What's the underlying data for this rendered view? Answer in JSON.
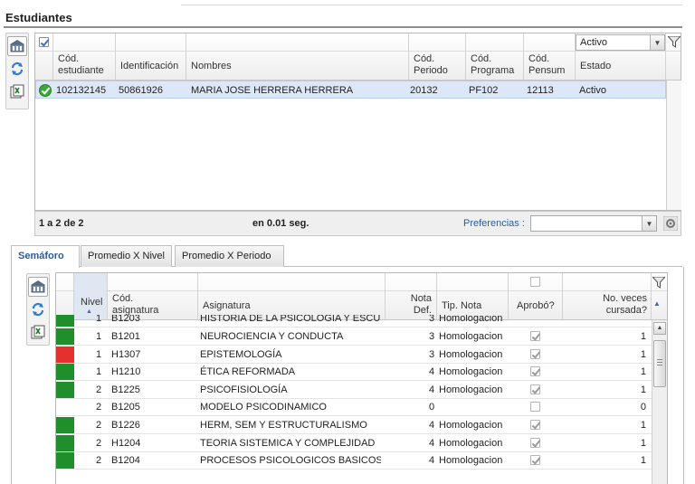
{
  "section": {
    "title": "Estudiantes"
  },
  "students": {
    "filter_value": "Activo",
    "columns": [
      "Cód.\nestudiante",
      "Identificación",
      "Nombres",
      "Cód.\nPeriodo",
      "Cód.\nPrograma",
      "Cód.\nPensum",
      "Estado"
    ],
    "rows": [
      {
        "codigo": "102132145",
        "identificacion": "50861926",
        "nombres": "MARIA JOSE HERRERA HERRERA",
        "periodo": "20132",
        "programa": "PF102",
        "pensum": "12113",
        "estado": "Activo",
        "selected": true
      }
    ]
  },
  "pager": {
    "range": "1 a 2 de 2",
    "time": "en 0.01 seg.",
    "prefs_label": "Preferencias :"
  },
  "tabs": [
    "Semáforo",
    "Promedio X Nivel",
    "Promedio X Periodo"
  ],
  "subjects": {
    "columns": [
      "Nivel",
      "Cód.\nasignatura",
      "Asignatura",
      "Nota\nDef.",
      "Tip. Nota",
      "Aprobó?",
      "No. veces\ncursada?"
    ],
    "colors": {
      "green": "#1f8f2b",
      "red": "#e53030"
    },
    "partial_top_row": {
      "nivel": "1",
      "codigo": "B1203",
      "asignatura": "HISTORIA DE LA PSICOLOGIA Y ESCUELA",
      "nota": "3",
      "tipo": "Homologacion"
    },
    "rows": [
      {
        "color": "green",
        "nivel": "1",
        "codigo": "B1201",
        "asignatura": "NEUROCIENCIA Y CONDUCTA",
        "nota": "3",
        "tipo": "Homologacion",
        "aprobo": true,
        "veces": "1"
      },
      {
        "color": "red",
        "nivel": "1",
        "codigo": "H1307",
        "asignatura": "EPISTEMOLOGÍA",
        "nota": "3",
        "tipo": "Homologacion",
        "aprobo": true,
        "veces": "1"
      },
      {
        "color": "green",
        "nivel": "1",
        "codigo": "H1210",
        "asignatura": "ÉTICA REFORMADA",
        "nota": "4",
        "tipo": "Homologacion",
        "aprobo": true,
        "veces": "1"
      },
      {
        "color": "green",
        "nivel": "2",
        "codigo": "B1225",
        "asignatura": "PSICOFISIOLOGÍA",
        "nota": "4",
        "tipo": "Homologacion",
        "aprobo": true,
        "veces": "1"
      },
      {
        "color": "none",
        "nivel": "2",
        "codigo": "B1205",
        "asignatura": "MODELO PSICODINAMICO",
        "nota": "0",
        "tipo": "",
        "aprobo": false,
        "veces": "0"
      },
      {
        "color": "green",
        "nivel": "2",
        "codigo": "B1226",
        "asignatura": "HERM, SEM Y ESTRUCTURALISMO",
        "nota": "4",
        "tipo": "Homologacion",
        "aprobo": true,
        "veces": "1"
      },
      {
        "color": "green",
        "nivel": "2",
        "codigo": "H1204",
        "asignatura": "TEORIA SISTEMICA Y COMPLEJIDAD",
        "nota": "4",
        "tipo": "Homologacion",
        "aprobo": true,
        "veces": "1"
      },
      {
        "color": "green",
        "nivel": "2",
        "codigo": "B1204",
        "asignatura": "PROCESOS PSICOLOGICOS BASICOS I",
        "nota": "4",
        "tipo": "Homologacion",
        "aprobo": true,
        "veces": "1"
      }
    ]
  },
  "icons": [
    "building-icon",
    "refresh-icon",
    "export-icon",
    "filter-icon",
    "dropdown-arrow-icon",
    "settings-icon",
    "check-circle-icon"
  ]
}
